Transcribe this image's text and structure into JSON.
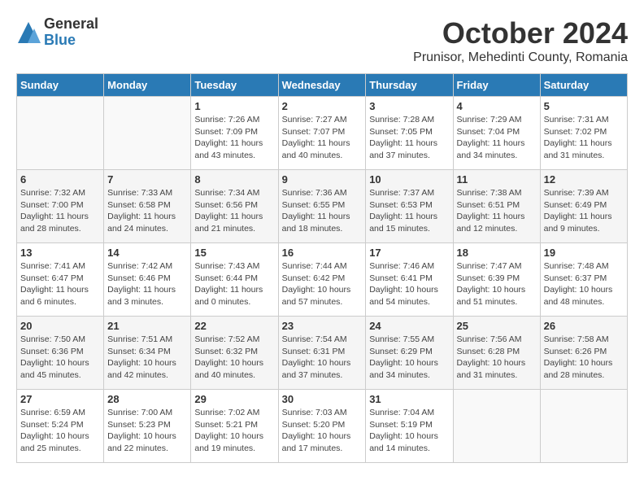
{
  "logo": {
    "general": "General",
    "blue": "Blue"
  },
  "title": "October 2024",
  "subtitle": "Prunisor, Mehedinti County, Romania",
  "days_of_week": [
    "Sunday",
    "Monday",
    "Tuesday",
    "Wednesday",
    "Thursday",
    "Friday",
    "Saturday"
  ],
  "weeks": [
    [
      {
        "day": "",
        "info": ""
      },
      {
        "day": "",
        "info": ""
      },
      {
        "day": "1",
        "info": "Sunrise: 7:26 AM\nSunset: 7:09 PM\nDaylight: 11 hours and 43 minutes."
      },
      {
        "day": "2",
        "info": "Sunrise: 7:27 AM\nSunset: 7:07 PM\nDaylight: 11 hours and 40 minutes."
      },
      {
        "day": "3",
        "info": "Sunrise: 7:28 AM\nSunset: 7:05 PM\nDaylight: 11 hours and 37 minutes."
      },
      {
        "day": "4",
        "info": "Sunrise: 7:29 AM\nSunset: 7:04 PM\nDaylight: 11 hours and 34 minutes."
      },
      {
        "day": "5",
        "info": "Sunrise: 7:31 AM\nSunset: 7:02 PM\nDaylight: 11 hours and 31 minutes."
      }
    ],
    [
      {
        "day": "6",
        "info": "Sunrise: 7:32 AM\nSunset: 7:00 PM\nDaylight: 11 hours and 28 minutes."
      },
      {
        "day": "7",
        "info": "Sunrise: 7:33 AM\nSunset: 6:58 PM\nDaylight: 11 hours and 24 minutes."
      },
      {
        "day": "8",
        "info": "Sunrise: 7:34 AM\nSunset: 6:56 PM\nDaylight: 11 hours and 21 minutes."
      },
      {
        "day": "9",
        "info": "Sunrise: 7:36 AM\nSunset: 6:55 PM\nDaylight: 11 hours and 18 minutes."
      },
      {
        "day": "10",
        "info": "Sunrise: 7:37 AM\nSunset: 6:53 PM\nDaylight: 11 hours and 15 minutes."
      },
      {
        "day": "11",
        "info": "Sunrise: 7:38 AM\nSunset: 6:51 PM\nDaylight: 11 hours and 12 minutes."
      },
      {
        "day": "12",
        "info": "Sunrise: 7:39 AM\nSunset: 6:49 PM\nDaylight: 11 hours and 9 minutes."
      }
    ],
    [
      {
        "day": "13",
        "info": "Sunrise: 7:41 AM\nSunset: 6:47 PM\nDaylight: 11 hours and 6 minutes."
      },
      {
        "day": "14",
        "info": "Sunrise: 7:42 AM\nSunset: 6:46 PM\nDaylight: 11 hours and 3 minutes."
      },
      {
        "day": "15",
        "info": "Sunrise: 7:43 AM\nSunset: 6:44 PM\nDaylight: 11 hours and 0 minutes."
      },
      {
        "day": "16",
        "info": "Sunrise: 7:44 AM\nSunset: 6:42 PM\nDaylight: 10 hours and 57 minutes."
      },
      {
        "day": "17",
        "info": "Sunrise: 7:46 AM\nSunset: 6:41 PM\nDaylight: 10 hours and 54 minutes."
      },
      {
        "day": "18",
        "info": "Sunrise: 7:47 AM\nSunset: 6:39 PM\nDaylight: 10 hours and 51 minutes."
      },
      {
        "day": "19",
        "info": "Sunrise: 7:48 AM\nSunset: 6:37 PM\nDaylight: 10 hours and 48 minutes."
      }
    ],
    [
      {
        "day": "20",
        "info": "Sunrise: 7:50 AM\nSunset: 6:36 PM\nDaylight: 10 hours and 45 minutes."
      },
      {
        "day": "21",
        "info": "Sunrise: 7:51 AM\nSunset: 6:34 PM\nDaylight: 10 hours and 42 minutes."
      },
      {
        "day": "22",
        "info": "Sunrise: 7:52 AM\nSunset: 6:32 PM\nDaylight: 10 hours and 40 minutes."
      },
      {
        "day": "23",
        "info": "Sunrise: 7:54 AM\nSunset: 6:31 PM\nDaylight: 10 hours and 37 minutes."
      },
      {
        "day": "24",
        "info": "Sunrise: 7:55 AM\nSunset: 6:29 PM\nDaylight: 10 hours and 34 minutes."
      },
      {
        "day": "25",
        "info": "Sunrise: 7:56 AM\nSunset: 6:28 PM\nDaylight: 10 hours and 31 minutes."
      },
      {
        "day": "26",
        "info": "Sunrise: 7:58 AM\nSunset: 6:26 PM\nDaylight: 10 hours and 28 minutes."
      }
    ],
    [
      {
        "day": "27",
        "info": "Sunrise: 6:59 AM\nSunset: 5:24 PM\nDaylight: 10 hours and 25 minutes."
      },
      {
        "day": "28",
        "info": "Sunrise: 7:00 AM\nSunset: 5:23 PM\nDaylight: 10 hours and 22 minutes."
      },
      {
        "day": "29",
        "info": "Sunrise: 7:02 AM\nSunset: 5:21 PM\nDaylight: 10 hours and 19 minutes."
      },
      {
        "day": "30",
        "info": "Sunrise: 7:03 AM\nSunset: 5:20 PM\nDaylight: 10 hours and 17 minutes."
      },
      {
        "day": "31",
        "info": "Sunrise: 7:04 AM\nSunset: 5:19 PM\nDaylight: 10 hours and 14 minutes."
      },
      {
        "day": "",
        "info": ""
      },
      {
        "day": "",
        "info": ""
      }
    ]
  ]
}
